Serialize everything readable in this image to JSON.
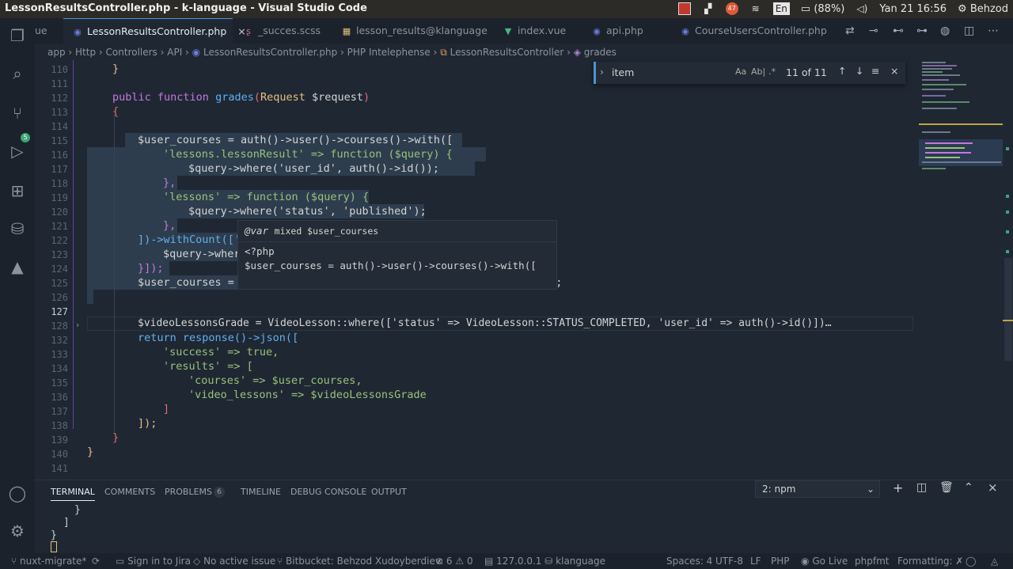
{
  "window_title": "LessonResultsController.php - k-language - Visual Studio Code",
  "os_tray": {
    "badge_count": "47",
    "keyboard_layout": "En",
    "battery": "(88%)",
    "datetime": "Yan 21 16:56",
    "user": "Behzod"
  },
  "tabs": [
    {
      "label": "ue",
      "icon": "php-icon"
    },
    {
      "label": "LessonResultsController.php",
      "icon": "php-icon",
      "active": true
    },
    {
      "label": "_succes.scss",
      "icon": "sass-icon"
    },
    {
      "label": "lesson_results@klanguage",
      "icon": "table-icon"
    },
    {
      "label": "index.vue",
      "icon": "vue-icon"
    },
    {
      "label": "api.php",
      "icon": "php-icon"
    },
    {
      "label": "CourseUsersController.php",
      "icon": "php-icon"
    }
  ],
  "breadcrumb": [
    "app",
    "Http",
    "Controllers",
    "API",
    "LessonResultsController.php",
    "PHP Intelephense",
    "LessonResultsController",
    "grades"
  ],
  "find": {
    "value": "item",
    "match_case": "Aa",
    "whole_word": "Ab|",
    "regex": ".*",
    "count": "11 of 11"
  },
  "hover": {
    "tag": "@var",
    "type": "mixed $user_courses",
    "code1": "<?php",
    "code2": "$user_courses = auth()->user()->courses()->with(["
  },
  "gutter": [
    "110",
    "111",
    "112",
    "113",
    "114",
    "115",
    "116",
    "117",
    "118",
    "119",
    "120",
    "121",
    "122",
    "123",
    "124",
    "125",
    "126",
    "127",
    "128",
    "132",
    "133",
    "134",
    "135",
    "136",
    "137",
    "138",
    "139",
    "140",
    "141"
  ],
  "code": {
    "l110": "}",
    "l112a": "public ",
    "l112b": "function ",
    "l112c": "grades",
    "l112d": "(",
    "l112e": "Request ",
    "l112f": "$request",
    "l112g": ")",
    "l113": "{",
    "l115": "$user_courses = auth()->user()->courses()->with([",
    "l116": "'lessons.lessonResult' => function ($query) {",
    "l117": "$query->where('user_id', auth()->id());",
    "l118": "},",
    "l119": "'lessons' => function ($query) {",
    "l120": "$query->where('status', 'published');",
    "l121": "},",
    "l122": "])->withCount(['",
    "l123": "$query->wher",
    "l124": "}]);",
    "l125": "$user_courses = $user_courses->where('trial', 0)->latest()->get();",
    "l128": "$videoLessonsGrade = VideoLesson::where(['status' => VideoLesson::STATUS_COMPLETED, 'user_id' => auth()->id()])…",
    "l132": "return response()->json([",
    "l133": "'success' => true,",
    "l134": "'results' => [",
    "l135": "'courses' => $user_courses,",
    "l136": "'video_lessons' => $videoLessonsGrade",
    "l137": "]",
    "l138": "]);",
    "l139": "}",
    "l140": "}"
  },
  "panel": {
    "tabs": [
      "TERMINAL",
      "COMMENTS",
      "PROBLEMS",
      "TIMELINE",
      "DEBUG CONSOLE",
      "OUTPUT"
    ],
    "problems_count": "6",
    "terminal_select": "2: npm",
    "terminal_lines": [
      "}",
      "]",
      "}"
    ]
  },
  "status": {
    "branch": "nuxt-migrate*",
    "jira": "Sign in to Jira",
    "issue": "No active issue",
    "bitbucket": "Bitbucket: Behzod Xudoyberdiev:",
    "errors": "6",
    "warnings": "0",
    "server": "127.0.0.1",
    "db": "klanguage",
    "spaces": "Spaces: 4",
    "encoding": "UTF-8",
    "eol": "LF",
    "language": "PHP",
    "golive": "Go Live",
    "phpfmt": "phpfmt",
    "formatting": "Formatting: ✗"
  },
  "colors": {
    "accent": "#4e94ce",
    "bg": "#1f2733",
    "selection": "#2d3d4e"
  }
}
